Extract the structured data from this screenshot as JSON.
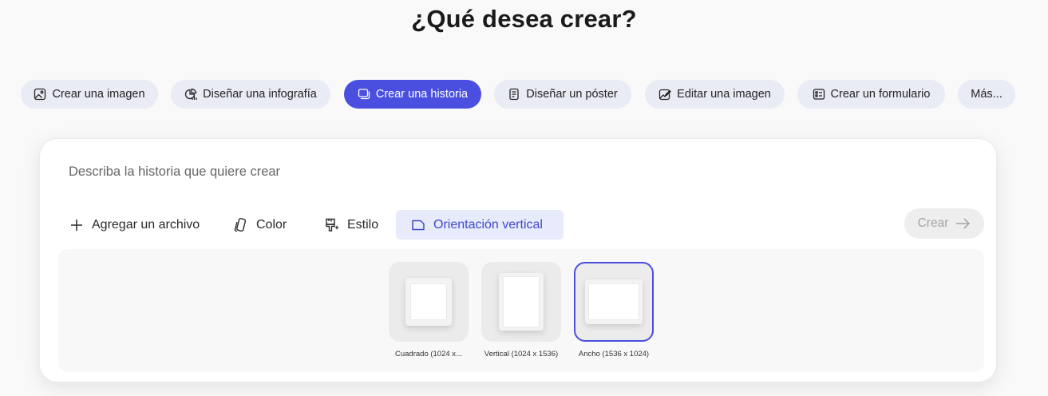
{
  "heading": "¿Qué desea crear?",
  "chips": [
    {
      "label": "Crear una imagen",
      "icon": "image-icon"
    },
    {
      "label": "Diseñar una infografía",
      "icon": "infographic-icon"
    },
    {
      "label": "Crear una historia",
      "icon": "story-icon",
      "active": true
    },
    {
      "label": "Diseñar un póster",
      "icon": "poster-icon"
    },
    {
      "label": "Editar una imagen",
      "icon": "edit-image-icon"
    },
    {
      "label": "Crear un formulario",
      "icon": "form-icon"
    },
    {
      "label": "Más..."
    }
  ],
  "composer": {
    "placeholder": "Describa la historia que quiere crear",
    "value": "",
    "tools": {
      "add_file": "Agregar un archivo",
      "color": "Color",
      "style": "Estilo",
      "orientation": "Orientación vertical"
    },
    "create_label": "Crear"
  },
  "orientation_options": [
    {
      "label": "Cuadrado (1024 x...",
      "selected": false
    },
    {
      "label": "Vertical (1024 x 1536)",
      "selected": false
    },
    {
      "label": "Ancho (1536 x 1024)",
      "selected": true
    }
  ],
  "colors": {
    "accent": "#4a4fe0",
    "chip_bg": "#e9ebf5",
    "active_tool_bg": "#e7ebfb"
  }
}
